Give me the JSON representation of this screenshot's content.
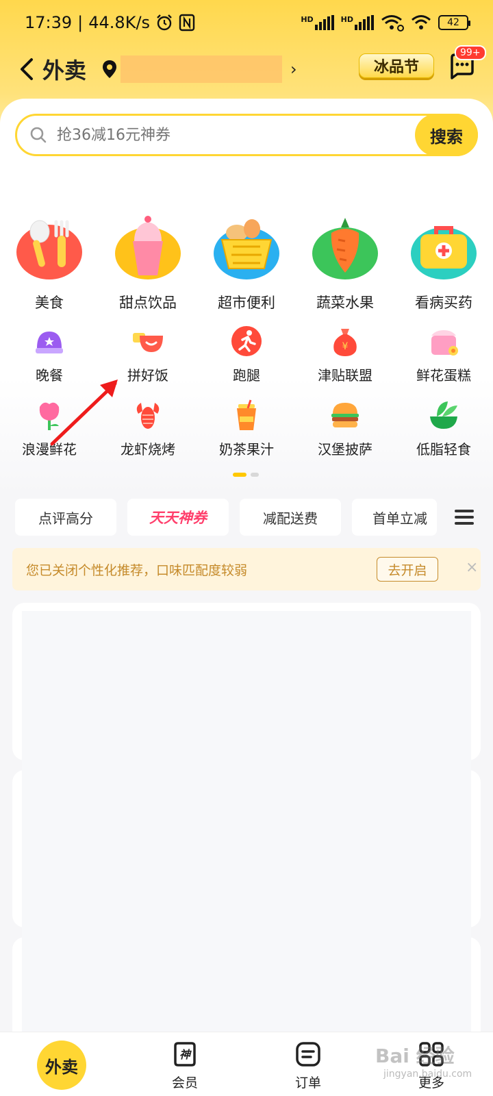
{
  "status_bar": {
    "time": "17:39",
    "net_speed": "44.8K/s",
    "battery": "42",
    "hd1": "HD",
    "hd2": "HD"
  },
  "nav": {
    "title": "外卖",
    "promo_button": "冰品节",
    "msg_badge": "99+"
  },
  "search": {
    "placeholder": "抢36减16元神券",
    "button": "搜索"
  },
  "categories_big": [
    {
      "label": "美食",
      "icon": "fork-spoon-icon",
      "color": "#ff5a4a"
    },
    {
      "label": "甜点饮品",
      "icon": "ice-cream-icon",
      "color": "#ffc21a"
    },
    {
      "label": "超市便利",
      "icon": "shopping-basket-icon",
      "color": "#2ab0f0"
    },
    {
      "label": "蔬菜水果",
      "icon": "carrot-icon",
      "color": "#3cc55a"
    },
    {
      "label": "看病买药",
      "icon": "medkit-icon",
      "color": "#2ccfc0"
    }
  ],
  "categories_small": [
    {
      "label": "晚餐",
      "icon": "dinner-dome-icon"
    },
    {
      "label": "拼好饭",
      "icon": "rice-bowl-icon"
    },
    {
      "label": "跑腿",
      "icon": "runner-icon"
    },
    {
      "label": "津贴联盟",
      "icon": "money-bag-icon"
    },
    {
      "label": "鲜花蛋糕",
      "icon": "cake-icon"
    },
    {
      "label": "浪漫鲜花",
      "icon": "flower-icon"
    },
    {
      "label": "龙虾烧烤",
      "icon": "lobster-icon"
    },
    {
      "label": "奶茶果汁",
      "icon": "milk-tea-icon"
    },
    {
      "label": "汉堡披萨",
      "icon": "burger-icon"
    },
    {
      "label": "低脂轻食",
      "icon": "salad-icon"
    }
  ],
  "filters": [
    "点评高分",
    "天天神券",
    "减配送费",
    "首单立减"
  ],
  "notice": {
    "text": "您已关闭个性化推荐，口味匹配度较弱",
    "button": "去开启",
    "close": "×"
  },
  "bottom_nav": {
    "home": "外卖",
    "member": "会员",
    "orders": "订单",
    "more": "更多"
  },
  "watermark": {
    "main": "Bai 经验",
    "sub": "jingyan.baidu.com"
  },
  "colors": {
    "accent": "#ffd633",
    "highlight": "#ff3f6c",
    "notice_text": "#c58a2a"
  }
}
